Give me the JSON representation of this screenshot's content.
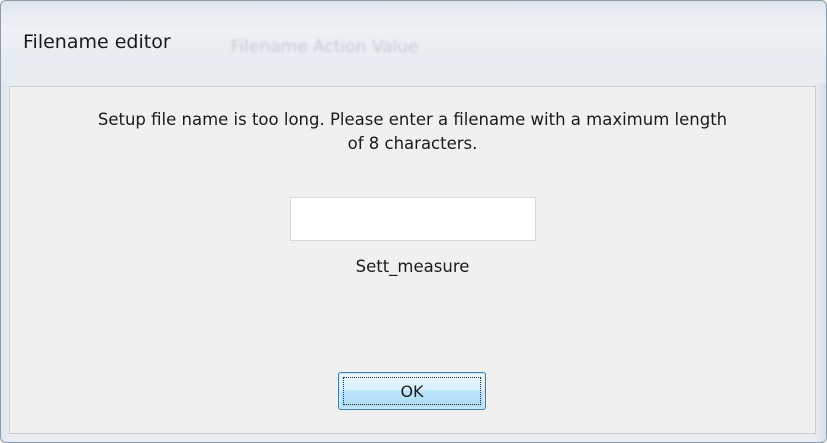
{
  "window": {
    "title": "Filename editor",
    "background_title_ghost": "Filename Action Value"
  },
  "dialog": {
    "message_line1": "Setup file name is too long. Please enter a filename with a maximum length",
    "message_line2": "of 8 characters.",
    "input": {
      "value": "",
      "placeholder": ""
    },
    "current_filename": "Sett_measure",
    "ok_label": "OK"
  },
  "colors": {
    "button_border": "#3c7fb1",
    "button_fill": "#bee6fd",
    "window_frame": "#e8edf2",
    "client_bg": "#f0f0f0"
  }
}
